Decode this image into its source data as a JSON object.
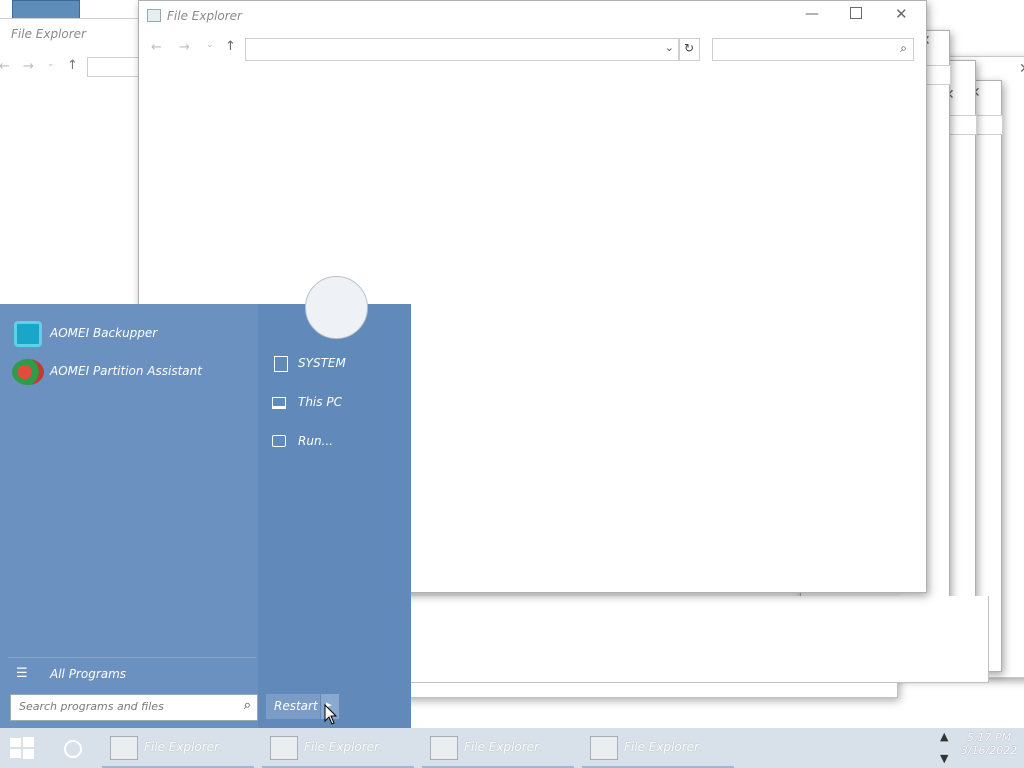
{
  "windows": {
    "back_title": "File Explorer",
    "front_title": "File Explorer"
  },
  "start_menu": {
    "programs": [
      {
        "label": "AOMEI Backupper",
        "icon": "aomei-backupper-icon"
      },
      {
        "label": "AOMEI Partition Assistant",
        "icon": "aomei-partition-icon"
      }
    ],
    "right_links": [
      {
        "label": "SYSTEM",
        "icon": "user-folder-icon"
      },
      {
        "label": "This PC",
        "icon": "computer-icon"
      },
      {
        "label": "Run...",
        "icon": "run-icon"
      }
    ],
    "all_programs_label": "All Programs",
    "search_placeholder": "Search programs and files",
    "power_label": "Restart"
  },
  "taskbar": {
    "items": [
      {
        "label": "File Explorer"
      },
      {
        "label": "File Explorer"
      },
      {
        "label": "File Explorer"
      },
      {
        "label": "File Explorer"
      }
    ],
    "time": "5:17 PM",
    "date": "3/16/2022"
  },
  "colors": {
    "start_menu_bg": "#6189b9",
    "taskbar_bg": "#d8e0e9"
  }
}
